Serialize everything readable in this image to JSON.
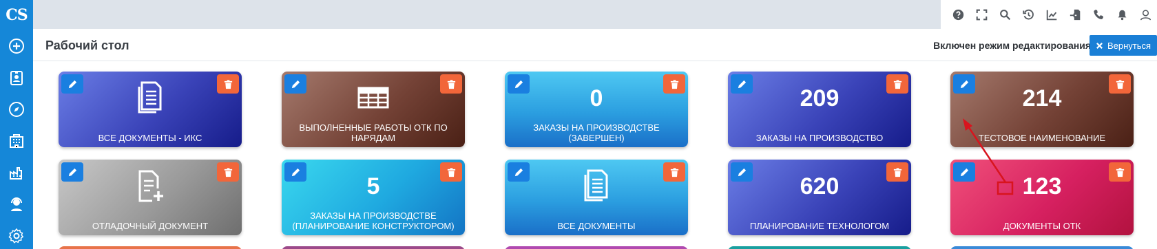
{
  "sidebar": {
    "logo": "CS",
    "items": [
      {
        "icon": "plus-circle-icon"
      },
      {
        "icon": "id-badge-icon"
      },
      {
        "icon": "compass-icon"
      },
      {
        "icon": "building-icon"
      },
      {
        "icon": "factory-icon"
      },
      {
        "icon": "user-headset-icon"
      },
      {
        "icon": "gear-icon"
      }
    ]
  },
  "topbar": {
    "icons": [
      "question-icon",
      "fullscreen-icon",
      "search-icon",
      "history-icon",
      "chart-icon",
      "import-icon",
      "phone-icon",
      "bell-icon",
      "user-icon"
    ]
  },
  "header": {
    "title": "Рабочий стол",
    "edit_mode_text": "Включен режим редактирования",
    "back_label": "Вернуться"
  },
  "tiles": [
    {
      "label": "ВСЕ ДОКУМЕНТЫ - ИКС",
      "value": "",
      "icon": "documents-icon",
      "color": "#3a43b8"
    },
    {
      "label": "ВЫПОЛНЕННЫЕ РАБОТЫ ОТК ПО НАРЯДАМ",
      "value": "",
      "icon": "table-icon",
      "color": "#744236"
    },
    {
      "label": "ЗАКАЗЫ НА ПРОИЗВОДСТВЕ (ЗАВЕРШЕН)",
      "value": "0",
      "icon": "",
      "color": "#2b9ee0"
    },
    {
      "label": "ЗАКАЗЫ НА ПРОИЗВОДСТВО",
      "value": "209",
      "icon": "",
      "color": "#3a43b8"
    },
    {
      "label": "ТЕСТОВОЕ НАИМЕНОВАНИЕ",
      "value": "214",
      "icon": "",
      "color": "#744236"
    },
    {
      "label": "ОТЛАДОЧНЫЙ ДОКУМЕНТ",
      "value": "",
      "icon": "file-plus-icon",
      "color": "#9a9a9a"
    },
    {
      "label": "ЗАКАЗЫ НА ПРОИЗВОДСТВЕ (ПЛАНИРОВАНИЕ КОНСТРУКТОРОМ)",
      "value": "5",
      "icon": "",
      "color": "#1fa9e0"
    },
    {
      "label": "ВСЕ ДОКУМЕНТЫ",
      "value": "",
      "icon": "documents-icon",
      "color": "#2b9ee0"
    },
    {
      "label": "ПЛАНИРОВАНИЕ ТЕХНОЛОГОМ",
      "value": "620",
      "icon": "",
      "color": "#3a43b8"
    },
    {
      "label": "ДОКУМЕНТЫ ОТК",
      "value": "123",
      "icon": "",
      "color": "#d62060"
    }
  ],
  "tile_buttons": {
    "edit_icon": "pencil-icon",
    "delete_icon": "trash-icon"
  }
}
